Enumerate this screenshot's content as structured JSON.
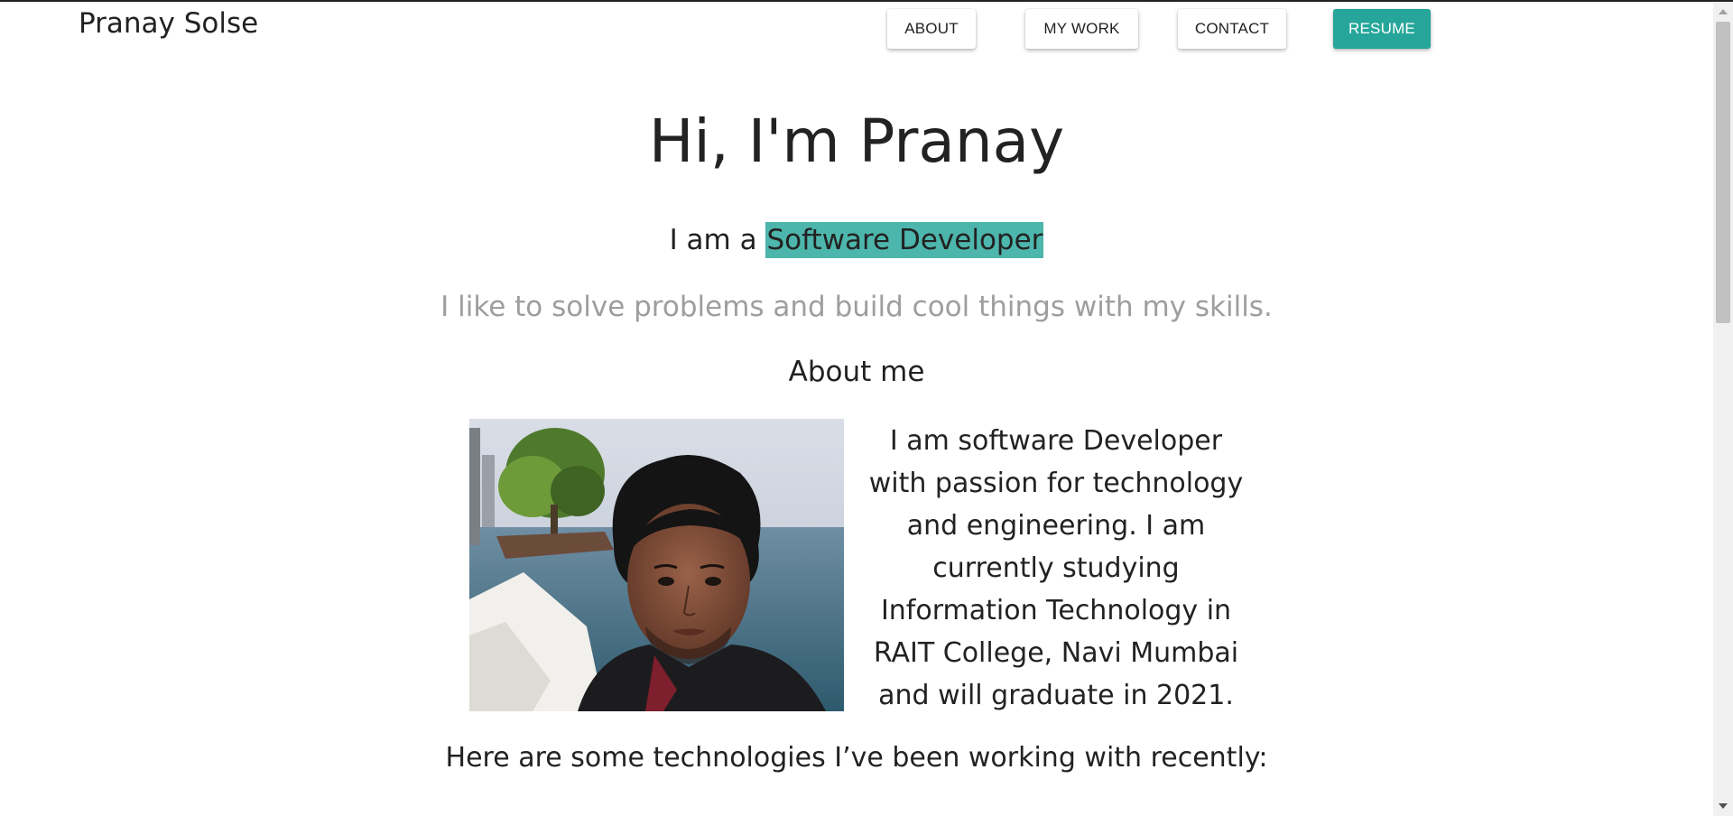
{
  "nav": {
    "brand": "Pranay Solse",
    "about": "ABOUT",
    "my_work": "MY WORK",
    "contact": "CONTACT",
    "resume": "RESUME"
  },
  "hero": {
    "title": "Hi, I'm Pranay",
    "role_prefix": "I am a",
    "role": "Software Developer",
    "tagline": "I like to solve problems and build cool things with my skills."
  },
  "about": {
    "heading": "About me",
    "bio": "I am software Developer with passion for technology and engineering. I am currently studying Information Technology in RAIT College, Navi Mumbai and will graduate in 2021."
  },
  "tech": {
    "intro": "Here are some technologies I’ve been working with recently:"
  },
  "colors": {
    "accent": "#26a69a",
    "highlight": "#4db6ac",
    "muted_text": "#9e9e9e"
  }
}
